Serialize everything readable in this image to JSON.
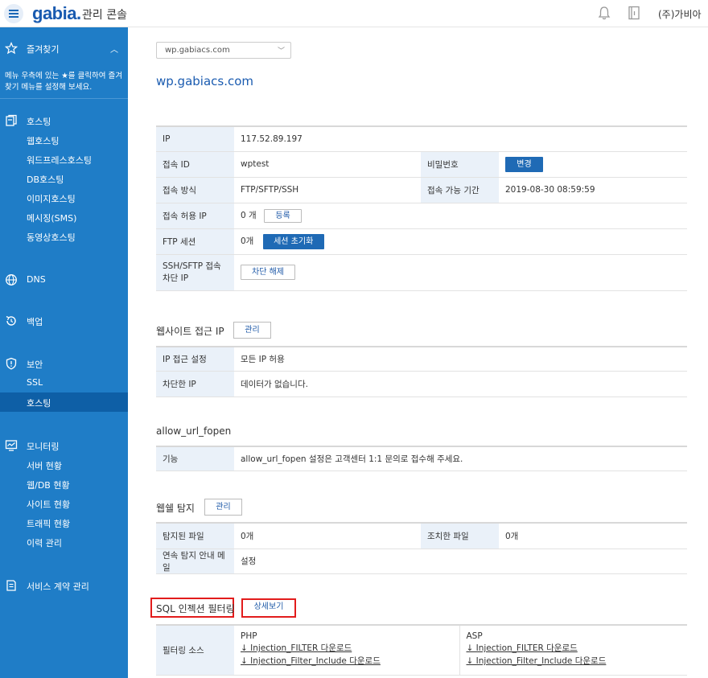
{
  "header": {
    "logo": "gabia.",
    "console_label": "관리 콘솔",
    "company": "(주)가비아"
  },
  "sidebar": {
    "favorites": {
      "title": "즐겨찾기",
      "desc": "메뉴 우측에 있는 ★를 클릭하여 즐겨찾기 메뉴를 설정해 보세요."
    },
    "hosting": {
      "title": "호스팅",
      "items": [
        "웹호스팅",
        "워드프레스호스팅",
        "DB호스팅",
        "이미지호스팅",
        "메시징(SMS)",
        "동영상호스팅"
      ]
    },
    "dns": "DNS",
    "backup": "백업",
    "security": {
      "title": "보안",
      "items": [
        "SSL",
        "호스팅"
      ]
    },
    "monitoring": {
      "title": "모니터링",
      "items": [
        "서버 현황",
        "웹/DB 현황",
        "사이트 현황",
        "트래픽 현황",
        "이력 관리"
      ]
    },
    "contract": "서비스 계약 관리"
  },
  "main": {
    "select_value": "wp.gabiacs.com",
    "domain_title": "wp.gabiacs.com",
    "conn": {
      "ip_label": "IP",
      "ip_value": "117.52.89.197",
      "id_label": "접속 ID",
      "id_value": "wptest",
      "pw_label": "비밀번호",
      "pw_btn": "변경",
      "method_label": "접속 방식",
      "method_value": "FTP/SFTP/SSH",
      "period_label": "접속 가능 기간",
      "period_value": "2019-08-30 08:59:59",
      "allow_ip_label": "접속 허용 IP",
      "allow_ip_value": "0 개",
      "allow_ip_btn": "등록",
      "ftp_label": "FTP 세션",
      "ftp_value": "0개",
      "ftp_btn": "세션 초기화",
      "ssh_label": "SSH/SFTP 접속 차단 IP",
      "ssh_btn": "차단 해제"
    },
    "web_access": {
      "title": "웹사이트 접근 IP",
      "btn": "관리",
      "setting_label": "IP 접근 설정",
      "setting_value": "모든 IP 허용",
      "blocked_label": "차단한 IP",
      "blocked_value": "데이터가 없습니다."
    },
    "allow_url": {
      "title": "allow_url_fopen",
      "label": "기능",
      "value": "allow_url_fopen 설정은 고객센터 1:1 문의로 접수해 주세요."
    },
    "webshell": {
      "title": "웹쉘 탐지",
      "btn": "관리",
      "detected_label": "탐지된 파일",
      "detected_value": "0개",
      "handled_label": "조치한 파일",
      "handled_value": "0개",
      "notice_label": "연속 탐지 안내 메일",
      "notice_value": "설정"
    },
    "sql": {
      "title": "SQL 인젝션 필터링",
      "btn": "상세보기",
      "source_label": "필터링 소스",
      "php_label": "PHP",
      "php_links": [
        "↓ Injection_FILTER 다운로드",
        "↓ Injection_Filter_Include 다운로드"
      ],
      "asp_label": "ASP",
      "asp_links": [
        "↓ Injection_FILTER 다운로드",
        "↓ Injection_Filter_Include 다운로드"
      ]
    }
  }
}
